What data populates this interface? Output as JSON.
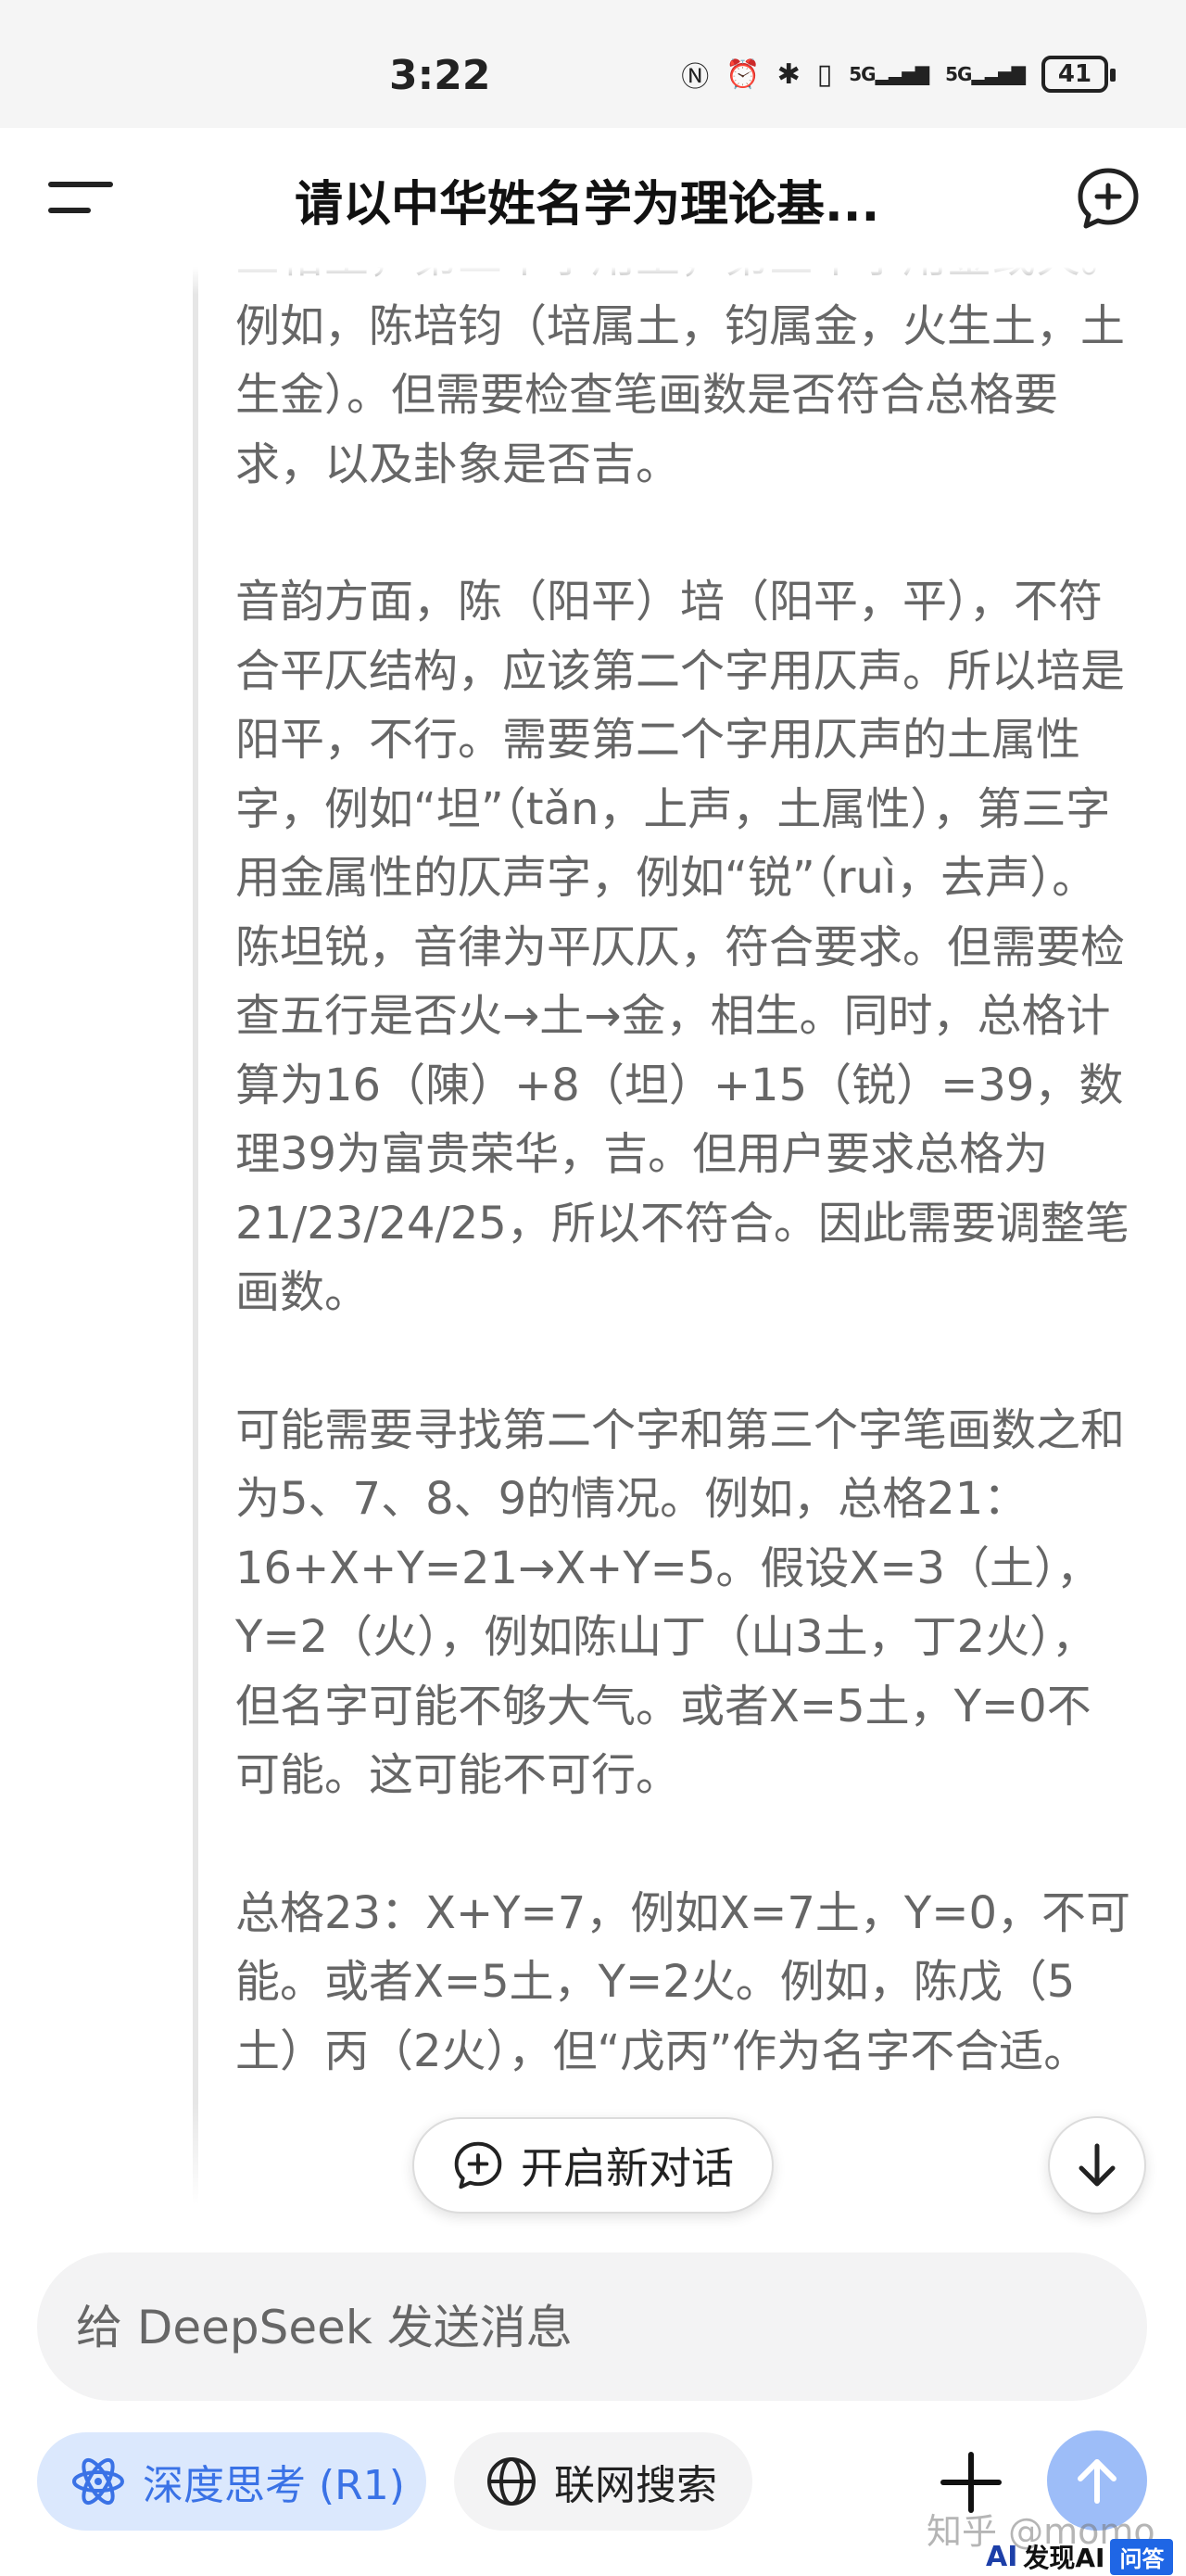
{
  "status_bar": {
    "time": "3:22",
    "nfc_icon": "Ⓝ",
    "alarm_icon": "⏰",
    "bluetooth_icon": "✱",
    "vibrate_icon": "▯",
    "signal1": "5G",
    "signal2": "5G",
    "battery": "41"
  },
  "header": {
    "title": "请以中华姓名学为理论基...",
    "menu_icon": "menu-icon",
    "new_chat_icon": "new-chat-icon"
  },
  "thinking": {
    "paragraphs": [
      "三格土，第二个字用土，第三个字用金或火。例如，陈培钧（培属土，钧属金，火生土，土生金）。但需要检查笔画数是否符合总格要求，以及卦象是否吉。",
      "音韵方面，陈（阳平）培（阳平，平），不符合平仄结构，应该第二个字用仄声。所以培是阳平，不行。需要第二个字用仄声的土属性字，例如“坦”（tǎn，上声，土属性），第三字用金属性的仄声字，例如“锐”（ruì，去声）。陈坦锐，音律为平仄仄，符合要求。但需要检查五行是否火→土→金，相生。同时，总格计算为16（陳）+8（坦）+15（锐）=39，数理39为富贵荣华，吉。但用户要求总格为21/23/24/25，所以不符合。因此需要调整笔画数。",
      "可能需要寻找第二个字和第三个字笔画数之和为5、7、8、9的情况。例如，总格21：16+X+Y=21→X+Y=5。假设X=3（土），Y=2（火），例如陈山丁（山3土，丁2火），但名字可能不够大气。或者X=5土，Y=0不可能。这可能不可行。",
      "总格23：X+Y=7，例如X=7土，Y=0，不可能。或者X=5土，Y=2火。例如，陈戊（5土）丙（2火），但“戊丙”作为名字不合适。"
    ]
  },
  "floating": {
    "new_dialog_label": "开启新对话",
    "scroll_down_icon": "arrow-down-icon"
  },
  "composer": {
    "placeholder": "给 DeepSeek 发送消息",
    "deep_think_label": "深度思考 (R1)",
    "web_search_label": "联网搜索",
    "attach_icon": "plus-icon",
    "send_icon": "arrow-up-icon"
  },
  "watermark": {
    "text": "知乎 @momo",
    "badge_logo": "AI",
    "badge_text": "发现AI",
    "badge_tag": "问答"
  }
}
